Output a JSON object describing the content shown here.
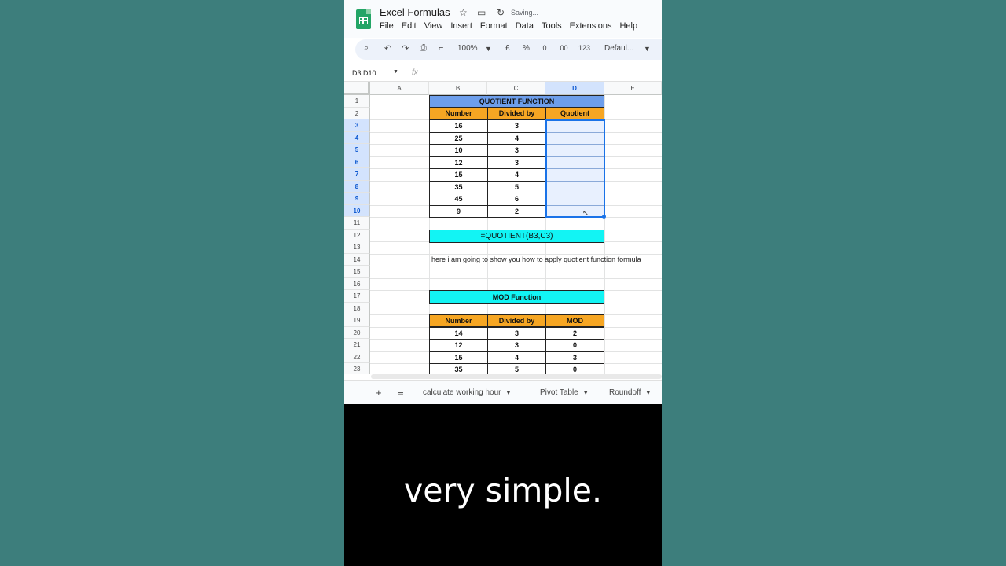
{
  "window": {
    "title": "Excel Formulas",
    "status": "Saving..."
  },
  "menu": [
    "File",
    "Edit",
    "View",
    "Insert",
    "Format",
    "Data",
    "Tools",
    "Extensions",
    "Help"
  ],
  "toolbar": {
    "zoom": "100%",
    "currency": "£",
    "percent": "%",
    "dec_less": ".0",
    "dec_more": ".00",
    "number_format": "123",
    "font": "Defaul..."
  },
  "formula_bar": {
    "name_box": "D3:D10",
    "fx_label": "fx",
    "formula": ""
  },
  "columns": [
    "A",
    "B",
    "C",
    "D",
    "E"
  ],
  "rows": [
    "1",
    "2",
    "3",
    "4",
    "5",
    "6",
    "7",
    "8",
    "9",
    "10",
    "11",
    "12",
    "13",
    "14",
    "15",
    "16",
    "17",
    "18",
    "19",
    "20",
    "21",
    "22",
    "23"
  ],
  "quotient_table": {
    "title": "QUOTIENT FUNCTION",
    "headers": [
      "Number",
      "Divided by",
      "Quotient"
    ],
    "rows": [
      [
        "16",
        "3",
        ""
      ],
      [
        "25",
        "4",
        ""
      ],
      [
        "10",
        "3",
        ""
      ],
      [
        "12",
        "3",
        ""
      ],
      [
        "15",
        "4",
        ""
      ],
      [
        "35",
        "5",
        ""
      ],
      [
        "45",
        "6",
        ""
      ],
      [
        "9",
        "2",
        ""
      ]
    ]
  },
  "formula_example": "=QUOTIENT(B3,C3)",
  "note": "here i am going to show you how to apply quotient function formula",
  "mod_table": {
    "title": "MOD Function",
    "headers": [
      "Number",
      "Divided by",
      "MOD"
    ],
    "rows": [
      [
        "14",
        "3",
        "2"
      ],
      [
        "12",
        "3",
        "0"
      ],
      [
        "15",
        "4",
        "3"
      ],
      [
        "35",
        "5",
        "0"
      ]
    ]
  },
  "sheet_tabs": [
    "calculate working hour",
    "Pivot Table",
    "Roundoff"
  ],
  "caption": "very simple.",
  "colors": {
    "header_orange": "#f6a623",
    "title_blue": "#6d9eeb",
    "cyan": "#12f4f4",
    "sheets_green": "#23a566"
  }
}
